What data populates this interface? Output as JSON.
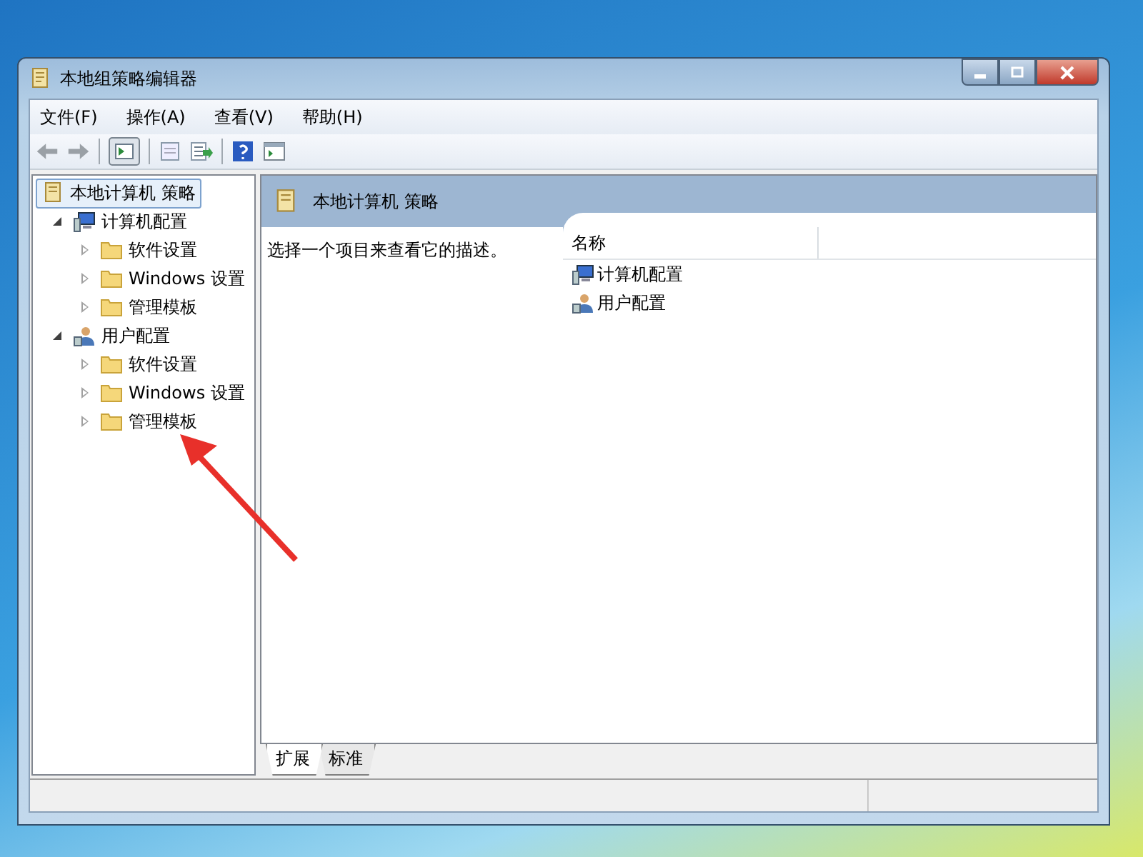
{
  "window": {
    "title": "本地组策略编辑器"
  },
  "menu": [
    {
      "label": "文件(F)"
    },
    {
      "label": "操作(A)"
    },
    {
      "label": "查看(V)"
    },
    {
      "label": "帮助(H)"
    }
  ],
  "tree": [
    {
      "label": "本地计算机 策略",
      "kind": "policy",
      "selected": true,
      "children": [
        {
          "label": "计算机配置",
          "kind": "computer",
          "selected": false,
          "expanded": true,
          "children": [
            {
              "label": "软件设置",
              "kind": "folder",
              "selected": false,
              "expanded": false
            },
            {
              "label": "Windows 设置",
              "kind": "folder",
              "selected": false,
              "expanded": false
            },
            {
              "label": "管理模板",
              "kind": "folder",
              "selected": false,
              "expanded": false
            }
          ]
        },
        {
          "label": "用户配置",
          "kind": "user",
          "selected": false,
          "expanded": true,
          "children": [
            {
              "label": "软件设置",
              "kind": "folder",
              "selected": false,
              "expanded": false
            },
            {
              "label": "Windows 设置",
              "kind": "folder",
              "selected": false,
              "expanded": false
            },
            {
              "label": "管理模板",
              "kind": "folder",
              "selected": false,
              "expanded": false
            }
          ]
        }
      ]
    }
  ],
  "details": {
    "header": "本地计算机 策略",
    "description": "选择一个项目来查看它的描述。",
    "columns": [
      "名称"
    ],
    "rows": [
      {
        "name": "计算机配置",
        "kind": "computer"
      },
      {
        "name": "用户配置",
        "kind": "user"
      }
    ]
  },
  "tabs": [
    {
      "label": "扩展",
      "selected": true
    },
    {
      "label": "标准",
      "selected": false
    }
  ]
}
